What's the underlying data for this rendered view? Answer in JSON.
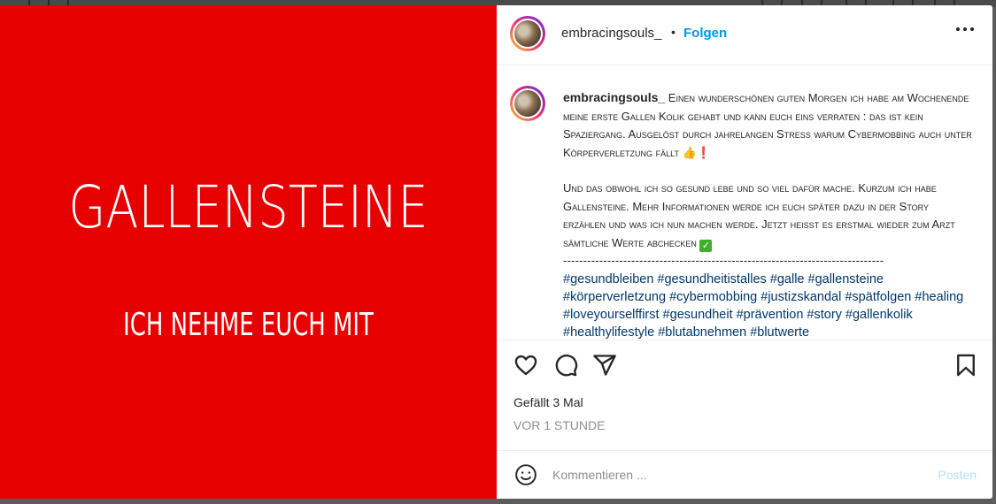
{
  "post": {
    "image": {
      "background": "#e60000",
      "title": "GALLENSTEINE",
      "subtitle": "ICH NEHME EUCH MIT"
    },
    "header": {
      "username": "embracingsouls_",
      "separator": "•",
      "follow_label": "Folgen",
      "more_icon": "more-horizontal-icon"
    },
    "caption": {
      "username": "embracingsouls_",
      "paragraph1": "Einen wunderschönen guten Morgen ich habe am Wochenende meine erste Gallen Kolik gehabt und kann euch eins verraten :   das ist kein Spaziergang. Ausgelöst durch jahrelangen Stress warum Cybermobbing auch unter Körperverletzung fällt",
      "paragraph1_emoji1": "👍",
      "paragraph1_emoji2": "❗",
      "paragraph2": "Und das obwohl ich so gesund lebe und so viel dafür mache. Kurzum ich habe Gallensteine. Mehr Informationen werde ich euch später dazu in der Story erzählen und was ich nun machen werde. Jetzt heisst es erstmal wieder zum Arzt sämtliche Werte abchecken",
      "paragraph2_emoji": "✓",
      "divider": "--------------------------------------------------------------------------------",
      "hashtags": "#gesundbleiben #gesundheitistalles #galle #gallensteine #körperverletzung #cybermobbing #justizskandal #spätfolgen #healing #loveyourselffirst #gesundheit #prävention #story #gallenkolik #healthylifestyle #blutabnehmen #blutwerte"
    },
    "actions": {
      "like_icon": "heart-icon",
      "comment_icon": "comment-icon",
      "share_icon": "paper-plane-icon",
      "save_icon": "bookmark-icon"
    },
    "likes_label": "Gefällt 3 Mal",
    "time_label": "VOR 1 STUNDE",
    "comment": {
      "emoji_icon": "smiley-icon",
      "placeholder": "Kommentieren ...",
      "post_label": "Posten"
    }
  },
  "colors": {
    "link_blue": "#0095f6",
    "hashtag_blue": "#00376b",
    "post_disabled": "#b2dffc",
    "muted_text": "#8e8e8e"
  }
}
